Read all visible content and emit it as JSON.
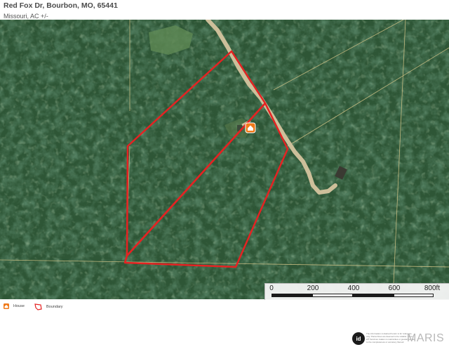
{
  "header": {
    "title": "Red Fox Dr, Bourbon, MO, 65441",
    "subtitle": "Missouri,  AC +/-"
  },
  "map": {
    "style": "satellite",
    "colors": {
      "forest_dark": "#1d4028",
      "forest_mid": "#2f5a36",
      "forest_light": "#4c7a4c",
      "road": "#c9b892",
      "boundary": "#e02020",
      "parcel_lines": "#d8c88a",
      "house_marker": "#f07a1a"
    },
    "scale": {
      "labels": [
        "0",
        "200",
        "400",
        "600",
        "800ft"
      ]
    }
  },
  "legend": {
    "house_label": "House",
    "boundary_label": "Boundary"
  },
  "footer": {
    "logo_text": "id",
    "disclaimer": "The information contained herein is for reference only. Parcel lines are deemed to be reliable. Land id® Services makes no warranties or guarantees as to the completeness or accuracy thereof.",
    "brand": "MARIS"
  }
}
